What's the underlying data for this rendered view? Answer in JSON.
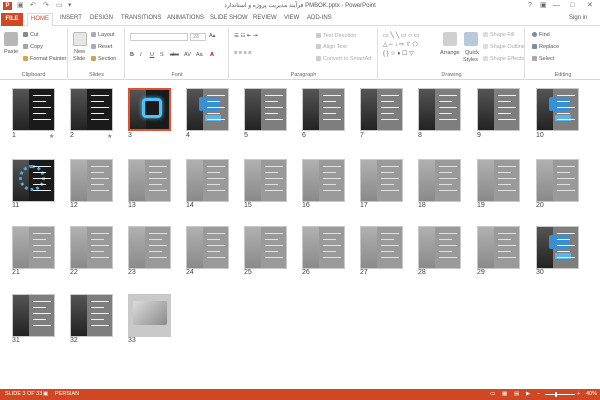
{
  "app": {
    "logo_text": "P",
    "title": "فرآیند مدیریت پروژه و استاندارد PMBOK.pptx - PowerPoint",
    "signin": "Sign in",
    "qat": {
      "save_icon": "save-icon",
      "undo_icon": "undo-icon",
      "redo_icon": "redo-icon",
      "start_icon": "start-from-beginning-icon"
    },
    "window_buttons": [
      "?",
      "▣",
      "—",
      "□",
      "✕"
    ]
  },
  "tabs": {
    "file": "FILE",
    "home": "HOME",
    "items": [
      "INSERT",
      "DESIGN",
      "TRANSITIONS",
      "ANIMATIONS",
      "SLIDE SHOW",
      "REVIEW",
      "VIEW",
      "ADD-INS"
    ]
  },
  "ribbon": {
    "clipboard": {
      "paste": "Paste",
      "cut": "Cut",
      "copy": "Copy",
      "format_painter": "Format Painter",
      "label": "Clipboard"
    },
    "slides": {
      "new_slide_line1": "New",
      "new_slide_line2": "Slide",
      "layout": "Layout",
      "reset": "Reset",
      "section": "Section",
      "label": "Slides"
    },
    "font": {
      "label": "Font",
      "size": "28",
      "buttons": [
        "B",
        "I",
        "U",
        "S",
        "abc",
        "AV",
        "Aa",
        "A"
      ]
    },
    "paragraph": {
      "label": "Paragraph",
      "text_direction": "Text Direction",
      "align_text": "Align Text",
      "convert_smartart": "Convert to SmartArt"
    },
    "drawing": {
      "label": "Drawing",
      "arrange": "Arrange",
      "quick_styles_line1": "Quick",
      "quick_styles_line2": "Styles",
      "shape_fill": "Shape Fill",
      "shape_outline": "Shape Outline",
      "shape_effects": "Shape Effects"
    },
    "editing": {
      "label": "Editing",
      "find": "Find",
      "replace": "Replace",
      "select": "Select"
    }
  },
  "slides": [
    {
      "n": "1",
      "star": "★"
    },
    {
      "n": "2",
      "star": "★"
    },
    {
      "n": "3",
      "star": ""
    },
    {
      "n": "4",
      "star": ""
    },
    {
      "n": "5",
      "star": ""
    },
    {
      "n": "6",
      "star": ""
    },
    {
      "n": "7",
      "star": ""
    },
    {
      "n": "8",
      "star": ""
    },
    {
      "n": "9",
      "star": ""
    },
    {
      "n": "10",
      "star": ""
    },
    {
      "n": "11",
      "star": ""
    },
    {
      "n": "12",
      "star": ""
    },
    {
      "n": "13",
      "star": ""
    },
    {
      "n": "14",
      "star": ""
    },
    {
      "n": "15",
      "star": ""
    },
    {
      "n": "16",
      "star": ""
    },
    {
      "n": "17",
      "star": ""
    },
    {
      "n": "18",
      "star": ""
    },
    {
      "n": "19",
      "star": ""
    },
    {
      "n": "20",
      "star": ""
    },
    {
      "n": "21",
      "star": ""
    },
    {
      "n": "22",
      "star": ""
    },
    {
      "n": "23",
      "star": ""
    },
    {
      "n": "24",
      "star": ""
    },
    {
      "n": "25",
      "star": ""
    },
    {
      "n": "26",
      "star": ""
    },
    {
      "n": "27",
      "star": ""
    },
    {
      "n": "28",
      "star": ""
    },
    {
      "n": "29",
      "star": ""
    },
    {
      "n": "30",
      "star": ""
    },
    {
      "n": "31",
      "star": ""
    },
    {
      "n": "32",
      "star": ""
    },
    {
      "n": "33",
      "star": ""
    }
  ],
  "selected_slide": "3",
  "status": {
    "slide_info": "SLIDE 3 OF 33",
    "language": "PERSIAN",
    "zoom": "40%",
    "zoom_out": "−",
    "zoom_in": "+"
  },
  "colors": {
    "accent": "#d24726",
    "status_bar": "#d04725"
  }
}
